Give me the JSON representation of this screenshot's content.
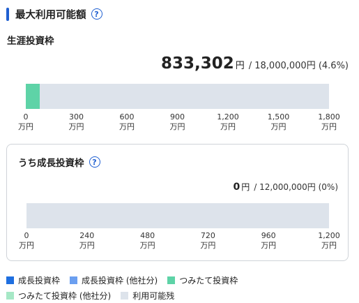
{
  "header": {
    "title": "最大利用可能額",
    "help": "?"
  },
  "lifetime": {
    "title": "生涯投資枠",
    "used": "833,302",
    "yen": "円",
    "limit_text": "/ 18,000,000円 (4.6%)",
    "fill_fraction": 0.046,
    "ticks": [
      {
        "value": "0",
        "unit": "万円"
      },
      {
        "value": "300",
        "unit": "万円"
      },
      {
        "value": "600",
        "unit": "万円"
      },
      {
        "value": "900",
        "unit": "万円"
      },
      {
        "value": "1,200",
        "unit": "万円"
      },
      {
        "value": "1,500",
        "unit": "万円"
      },
      {
        "value": "1,800",
        "unit": "万円"
      }
    ]
  },
  "growth": {
    "title": "うち成長投資枠",
    "help": "?",
    "used": "0",
    "yen": "円",
    "limit_text": "/ 12,000,000円 (0%)",
    "fill_fraction": 0,
    "ticks": [
      {
        "value": "0",
        "unit": "万円"
      },
      {
        "value": "240",
        "unit": "万円"
      },
      {
        "value": "480",
        "unit": "万円"
      },
      {
        "value": "720",
        "unit": "万円"
      },
      {
        "value": "960",
        "unit": "万円"
      },
      {
        "value": "1,200",
        "unit": "万円"
      }
    ]
  },
  "legend": [
    {
      "label": "成長投資枠",
      "color": "#1f6fe0"
    },
    {
      "label": "成長投資枠 (他社分)",
      "color": "#6b9ff0"
    },
    {
      "label": "つみたて投資枠",
      "color": "#5ed3a7"
    },
    {
      "label": "つみたて投資枠 (他社分)",
      "color": "#a6e8c6"
    },
    {
      "label": "利用可能残",
      "color": "#dde3eb"
    }
  ]
}
